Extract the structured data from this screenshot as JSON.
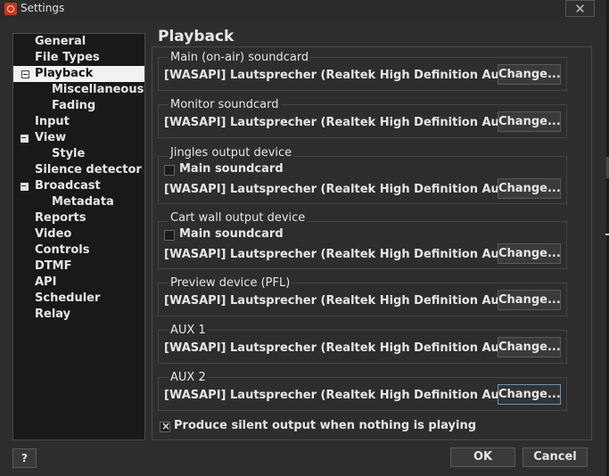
{
  "window": {
    "title": "Settings",
    "close_label": "✕"
  },
  "sidebar": {
    "items": [
      {
        "label": "General"
      },
      {
        "label": "File Types"
      },
      {
        "label": "Playback",
        "selected": true
      },
      {
        "label": "Miscellaneous"
      },
      {
        "label": "Fading"
      },
      {
        "label": "Input"
      },
      {
        "label": "View"
      },
      {
        "label": "Style"
      },
      {
        "label": "Silence detector"
      },
      {
        "label": "Broadcast"
      },
      {
        "label": "Metadata"
      },
      {
        "label": "Reports"
      },
      {
        "label": "Video"
      },
      {
        "label": "Controls"
      },
      {
        "label": "DTMF"
      },
      {
        "label": "API"
      },
      {
        "label": "Scheduler"
      },
      {
        "label": "Relay"
      }
    ]
  },
  "panel": {
    "title": "Playback",
    "change_label": "Change...",
    "groups": [
      {
        "label": "Main (on-air) soundcard",
        "device": "[WASAPI] Lautsprecher (Realtek High Definition Audio)"
      },
      {
        "label": "Monitor soundcard",
        "device": "[WASAPI] Lautsprecher (Realtek High Definition Audio)"
      },
      {
        "label": "Jingles output device",
        "checkbox_label": "Main soundcard",
        "checked": false,
        "device": "[WASAPI] Lautsprecher (Realtek High Definition Audio)"
      },
      {
        "label": "Cart wall output device",
        "checkbox_label": "Main soundcard",
        "checked": false,
        "device": "[WASAPI] Lautsprecher (Realtek High Definition Audio)"
      },
      {
        "label": "Preview device (PFL)",
        "device": "[WASAPI] Lautsprecher (Realtek High Definition Audio)"
      },
      {
        "label": "AUX 1",
        "device": "[WASAPI] Lautsprecher (Realtek High Definition Audio)"
      },
      {
        "label": "AUX 2",
        "device": "[WASAPI] Lautsprecher (Realtek High Definition Audio)"
      }
    ],
    "silent_output": {
      "label": "Produce silent output when nothing is playing",
      "checked": true
    }
  },
  "footer": {
    "help_label": "?",
    "ok_label": "OK",
    "cancel_label": "Cancel"
  }
}
